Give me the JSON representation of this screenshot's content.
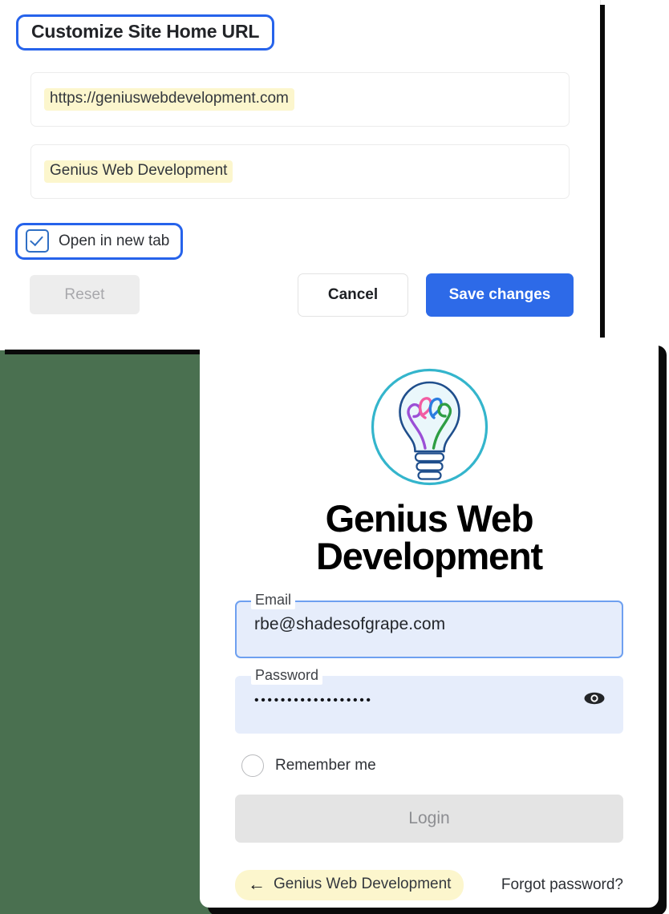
{
  "background": {
    "green_color": "#4a7050"
  },
  "customize_panel": {
    "title": "Customize Site Home URL",
    "url_field": {
      "value": "https://geniuswebdevelopment.com",
      "highlight_color": "#fcf6cd"
    },
    "title_field": {
      "value": "Genius Web Development",
      "highlight_color": "#fcf6cd"
    },
    "checkbox": {
      "label": "Open in new tab",
      "checked": true,
      "accent_color": "#2663eb"
    },
    "buttons": {
      "reset": "Reset",
      "cancel": "Cancel",
      "save": "Save changes",
      "save_color": "#2d6ae8"
    }
  },
  "login_panel": {
    "logo": {
      "icon": "lightbulb-icon",
      "circle_color": "#34b5cc",
      "bulb_color": "#1f4e8c",
      "filament_colors": [
        "#9b4fd6",
        "#f25ca2",
        "#2b7de0",
        "#2e9e44"
      ]
    },
    "brand_title": "Genius Web\nDevelopment",
    "brand_title_line1": "Genius Web",
    "brand_title_line2": "Development",
    "email": {
      "label": "Email",
      "value": "rbe@shadesofgrape.com",
      "focused": true
    },
    "password": {
      "label": "Password",
      "value": "••••••••••••••••••",
      "toggle_icon": "eye-icon"
    },
    "remember": {
      "label": "Remember me",
      "checked": false
    },
    "login_button": {
      "label": "Login",
      "disabled": true
    },
    "footer": {
      "back_arrow": "←",
      "back_label": "Genius Web Development",
      "forgot_label": "Forgot password?",
      "back_highlight_color": "#fcf6cd"
    }
  }
}
